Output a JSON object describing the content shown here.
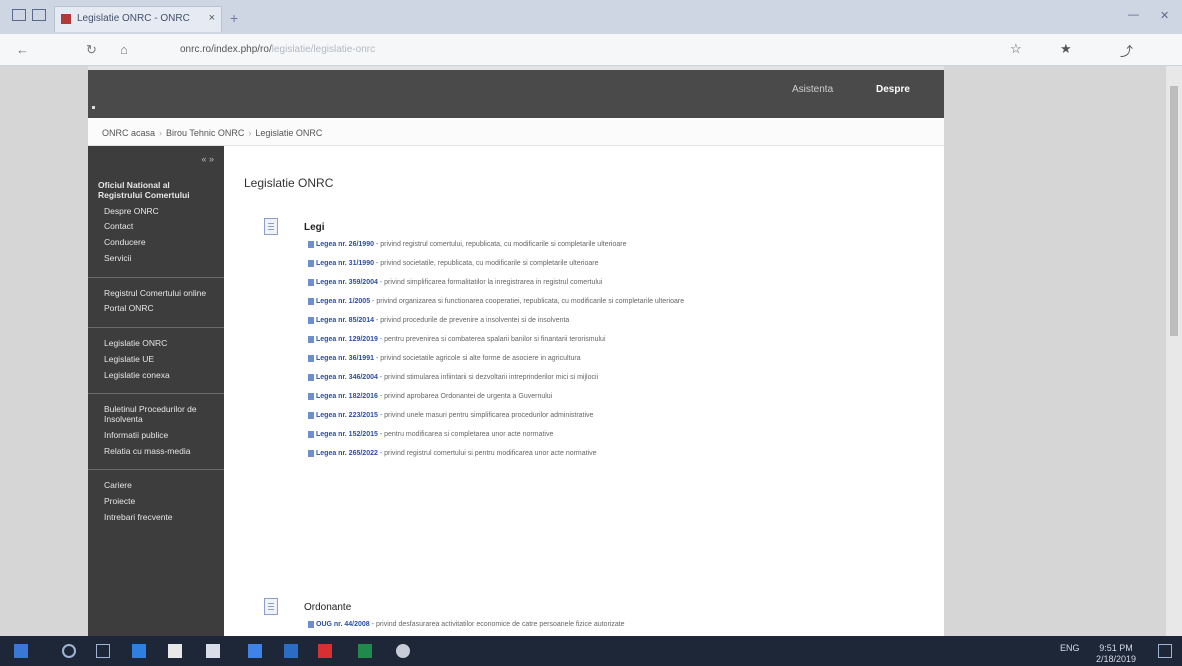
{
  "browser": {
    "tab_title": "Legislatie ONRC - ONRC",
    "tab_close": "×",
    "new_tab": "+",
    "url": "onrc.ro/index.php/ro/",
    "url_tail": "legislatie/legislatie-onrc",
    "nav": {
      "back": "←",
      "refresh": "↻",
      "home": "⌂"
    },
    "tools": {
      "favorite": "☆",
      "hub": "★",
      "share": "⤴"
    }
  },
  "site_header": {
    "link": "Asistenta",
    "strong_link": "Despre"
  },
  "breadcrumb": {
    "parts": [
      "ONRC acasa",
      "Birou Tehnic ONRC",
      "Legislatie ONRC"
    ]
  },
  "sidenav": {
    "toggle": "« »",
    "groups": [
      {
        "items": [
          "Oficiul National al Registrului Comertului",
          "Despre ONRC",
          "Contact",
          "Conducere",
          "Servicii"
        ]
      },
      {
        "items": [
          "Registrul Comertului online",
          "Portal ONRC"
        ]
      },
      {
        "items": [
          "Legislatie ONRC",
          "Legislatie UE",
          "Legislatie conexa"
        ]
      },
      {
        "items": [
          "Buletinul Procedurilor de Insolventa",
          "Informatii publice",
          "Relatia cu mass-media"
        ]
      },
      {
        "items": [
          "Cariere",
          "Proiecte",
          "Intrebari frecvente"
        ]
      }
    ]
  },
  "content": {
    "title": "Legislatie ONRC",
    "sections": [
      {
        "title": "Legi",
        "links": [
          {
            "name": "Legea nr. 26/1990",
            "text": "privind registrul comertului, republicata, cu modificarile si completarile ulterioare"
          },
          {
            "name": "Legea nr. 31/1990",
            "text": "privind societatile, republicata, cu modificarile si completarile ulterioare"
          },
          {
            "name": "Legea nr. 359/2004",
            "text": "privind simplificarea formalitatilor la inregistrarea in registrul comertului"
          },
          {
            "name": "Legea nr. 1/2005",
            "text": "privind organizarea si functionarea cooperatiei, republicata, cu modificarile si completarile ulterioare"
          },
          {
            "name": "Legea nr. 85/2014",
            "text": "privind procedurile de prevenire a insolventei si de insolventa"
          },
          {
            "name": "Legea nr. 129/2019",
            "text": "pentru prevenirea si combaterea spalarii banilor si finantarii terorismului"
          },
          {
            "name": "Legea nr. 36/1991",
            "text": "privind societatile agricole si alte forme de asociere in agricultura"
          },
          {
            "name": "Legea nr. 346/2004",
            "text": "privind stimularea infiintarii si dezvoltarii intreprinderilor mici si mijlocii"
          },
          {
            "name": "Legea nr. 182/2016",
            "text": "privind aprobarea Ordonantei de urgenta a Guvernului"
          },
          {
            "name": "Legea nr. 223/2015",
            "text": "privind unele masuri pentru simplificarea procedurilor administrative"
          },
          {
            "name": "Legea nr. 152/2015",
            "text": "pentru modificarea si completarea unor acte normative"
          },
          {
            "name": "Legea nr. 265/2022",
            "text": "privind registrul comertului si pentru modificarea unor acte normative"
          }
        ]
      },
      {
        "title": "Ordonante",
        "links": [
          {
            "name": "OUG nr. 44/2008",
            "text": "privind desfasurarea activitatilor economice de catre persoanele fizice autorizate"
          }
        ]
      }
    ]
  },
  "taskbar": {
    "time": "9:51 PM",
    "date": "2/18/2019",
    "lang": "ENG"
  }
}
